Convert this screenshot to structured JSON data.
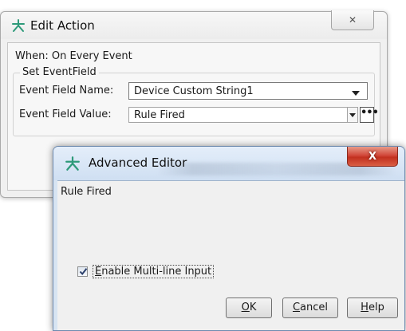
{
  "edit_action": {
    "title": "Edit Action",
    "close_glyph": "✕",
    "when_text": "When: On Every Event",
    "group_label": "Set EventField",
    "field_name_label": "Event Field Name:",
    "field_name_value": "Device Custom String1",
    "field_value_label": "Event Field Value:",
    "field_value_value": "Rule Fired",
    "ellipsis_label": "•••"
  },
  "advanced_editor": {
    "title": "Advanced Editor",
    "close_glyph": "X",
    "text_value": "Rule Fired",
    "checkbox_checked": true,
    "checkbox_label_first": "E",
    "checkbox_label_rest": "nable Multi-line Input",
    "ok_first": "O",
    "ok_rest": "K",
    "cancel_first": "C",
    "cancel_rest": "ancel",
    "help_first": "H",
    "help_rest": "elp"
  },
  "icons": {
    "app_icon": "rule-star-icon",
    "app_icon_color": "#2e9a7a"
  }
}
